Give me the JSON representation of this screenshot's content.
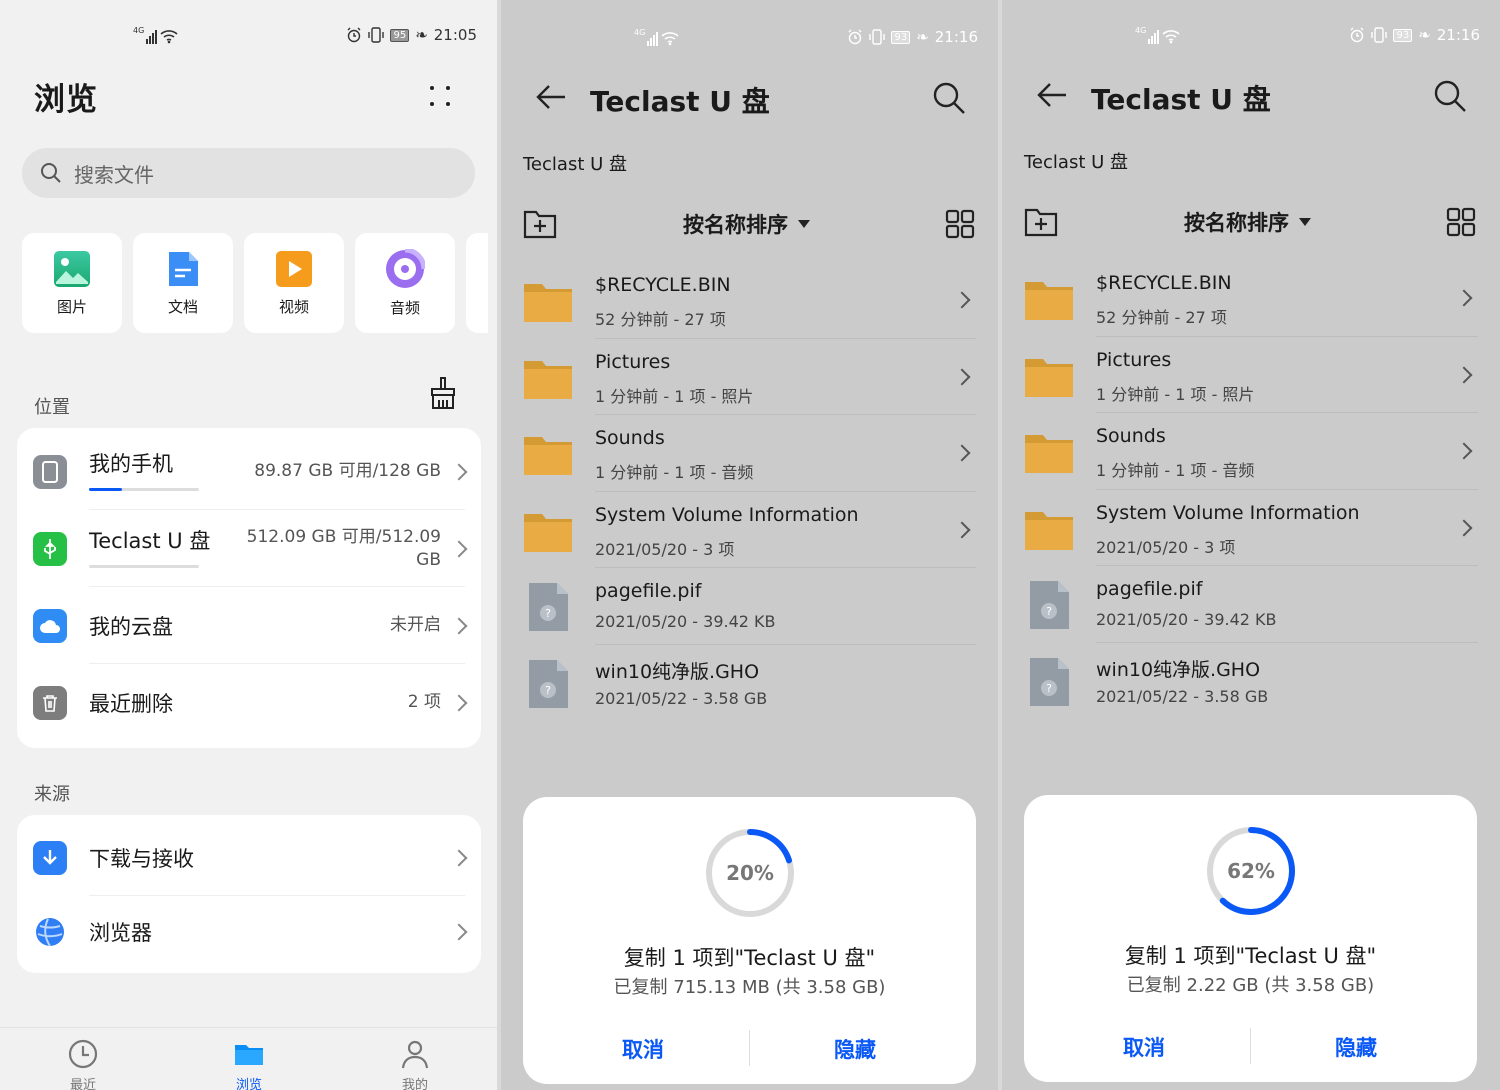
{
  "colors": {
    "accent": "#0a59f7",
    "folder": "#e8a838",
    "unknown_file": "#9aa3ad"
  },
  "phone": {
    "status": {
      "network": "4G",
      "battery": "95",
      "time": "21:05"
    },
    "title": "浏览",
    "search": {
      "placeholder": "搜索文件"
    },
    "categories": [
      {
        "label": "图片",
        "icon": "image-icon"
      },
      {
        "label": "文档",
        "icon": "document-icon"
      },
      {
        "label": "视频",
        "icon": "video-icon"
      },
      {
        "label": "音频",
        "icon": "audio-icon"
      }
    ],
    "locations_label": "位置",
    "locations": [
      {
        "name": "我的手机",
        "value": "89.87 GB 可用/128 GB",
        "usage": 0.3,
        "icon": "phone-icon"
      },
      {
        "name": "Teclast U 盘",
        "value": "512.09 GB 可用/512.09 GB",
        "usage": 0.0,
        "icon": "usb-icon"
      },
      {
        "name": "我的云盘",
        "value": "未开启",
        "icon": "cloud-icon"
      },
      {
        "name": "最近删除",
        "value": "2 项",
        "icon": "trash-icon"
      }
    ],
    "sources_label": "来源",
    "sources": [
      {
        "name": "下载与接收",
        "icon": "download-icon"
      },
      {
        "name": "浏览器",
        "icon": "browser-icon"
      }
    ],
    "tabs": [
      {
        "label": "最近",
        "icon": "clock-icon"
      },
      {
        "label": "浏览",
        "icon": "folder-icon",
        "active": true
      },
      {
        "label": "我的",
        "icon": "person-icon"
      }
    ]
  },
  "usb_views": [
    {
      "status": {
        "network": "4G",
        "battery": "93",
        "time": "21:16"
      },
      "title": "Teclast U 盘",
      "breadcrumb": "Teclast U 盘",
      "sort_label": "按名称排序",
      "files": [
        {
          "name": "$RECYCLE.BIN",
          "meta": "52 分钟前 - 27 项",
          "type": "folder"
        },
        {
          "name": "Pictures",
          "meta": "1 分钟前 - 1 项 - 照片",
          "type": "folder"
        },
        {
          "name": "Sounds",
          "meta": "1 分钟前 - 1 项 - 音频",
          "type": "folder"
        },
        {
          "name": "System Volume Information",
          "meta": "2021/05/20 - 3 项",
          "type": "folder"
        },
        {
          "name": "pagefile.pif",
          "meta": "2021/05/20 - 39.42 KB",
          "type": "file"
        },
        {
          "name": "win10纯净版.GHO",
          "meta": "2021/05/22 - 3.58 GB",
          "type": "file"
        }
      ],
      "dialog": {
        "percent_label": "20%",
        "progress": 0.2,
        "title": "复制 1 项到\"Teclast U 盘\"",
        "subtitle": "已复制 715.13 MB (共 3.58 GB)",
        "cancel": "取消",
        "hide": "隐藏"
      }
    },
    {
      "status": {
        "network": "4G",
        "battery": "93",
        "time": "21:16"
      },
      "title": "Teclast U 盘",
      "breadcrumb": "Teclast U 盘",
      "sort_label": "按名称排序",
      "files": [
        {
          "name": "$RECYCLE.BIN",
          "meta": "52 分钟前 - 27 项",
          "type": "folder"
        },
        {
          "name": "Pictures",
          "meta": "1 分钟前 - 1 项 - 照片",
          "type": "folder"
        },
        {
          "name": "Sounds",
          "meta": "1 分钟前 - 1 项 - 音频",
          "type": "folder"
        },
        {
          "name": "System Volume Information",
          "meta": "2021/05/20 - 3 项",
          "type": "folder"
        },
        {
          "name": "pagefile.pif",
          "meta": "2021/05/20 - 39.42 KB",
          "type": "file"
        },
        {
          "name": "win10纯净版.GHO",
          "meta": "2021/05/22 - 3.58 GB",
          "type": "file"
        }
      ],
      "dialog": {
        "percent_label": "62%",
        "progress": 0.62,
        "title": "复制 1 项到\"Teclast U 盘\"",
        "subtitle": "已复制 2.22 GB (共 3.58 GB)",
        "cancel": "取消",
        "hide": "隐藏"
      }
    }
  ]
}
